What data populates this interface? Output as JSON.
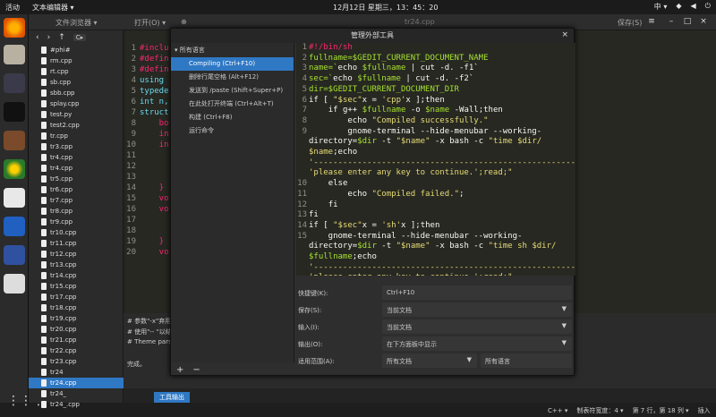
{
  "topbar": {
    "activities": "活动",
    "app_menu": "文本编辑器 ▾",
    "clock": "12月12日 星期三，13：45：20",
    "input_method": "中 ▾"
  },
  "header": {
    "browser_title": "文件浏览器 ▾",
    "open_label": "打开(O) ▾",
    "file_tab": "tr24.cpp",
    "save_label": "保存(S)"
  },
  "sidebar": {
    "location": "C▸",
    "files": [
      "#phi#",
      "rm.cpp",
      "rt.cpp",
      "sb.cpp",
      "sbb.cpp",
      "splay.cpp",
      "test.py",
      "test2.cpp",
      "tr.cpp",
      "tr3.cpp",
      "tr4.cpp",
      "tr4.cpp",
      "tr5.cpp",
      "tr6.cpp",
      "tr7.cpp",
      "tr8.cpp",
      "tr9.cpp",
      "tr10.cpp",
      "tr11.cpp",
      "tr12.cpp",
      "tr13.cpp",
      "tr14.cpp",
      "tr15.cpp",
      "tr17.cpp",
      "tr18.cpp",
      "tr19.cpp",
      "tr20.cpp",
      "tr21.cpp",
      "tr22.cpp",
      "tr23.cpp",
      "tr24",
      "tr24.cpp",
      "tr24_",
      "tr24_.cpp"
    ],
    "selected_index": 31
  },
  "editor": {
    "lines": [
      {
        "n": "1",
        "t": "#inclu"
      },
      {
        "n": "2",
        "t": "#defin"
      },
      {
        "n": "3",
        "t": "#defin"
      },
      {
        "n": "4",
        "t": "using "
      },
      {
        "n": "5",
        "t": "typede"
      },
      {
        "n": "6",
        "t": "int n,"
      },
      {
        "n": "7",
        "t": "struct"
      },
      {
        "n": "8",
        "t": "    bo"
      },
      {
        "n": "9",
        "t": "    in"
      },
      {
        "n": "10",
        "t": "    in"
      },
      {
        "n": "11",
        "t": ""
      },
      {
        "n": "12",
        "t": ""
      },
      {
        "n": "13",
        "t": ""
      },
      {
        "n": "14",
        "t": "    }"
      },
      {
        "n": "15",
        "t": "    vo"
      },
      {
        "n": "16",
        "t": "    vo"
      },
      {
        "n": "17",
        "t": ""
      },
      {
        "n": "18",
        "t": ""
      },
      {
        "n": "19",
        "t": "    }"
      },
      {
        "n": "20",
        "t": "    vo"
      }
    ]
  },
  "lower_pane": {
    "line1": "# 参数\"-x\"弃用...",
    "line2": "# 使用\"-- \"以结...",
    "line3": "# Theme parsing...",
    "done": "完成。",
    "tool_output_tab": "工具输出"
  },
  "status": {
    "lang": "C++ ▾",
    "tab_width": "制表符宽度：4 ▾",
    "position": "第 7 行，第 18 列 ▾",
    "mode": "插入"
  },
  "dialog": {
    "title": "管理外部工具",
    "tools_heading": "所有语言",
    "tools": [
      "Compiling (Ctrl+F10)",
      "删除行尾空格 (Alt+F12)",
      "发送到 /paste (Shift+Super+P)",
      "在此处打开终端 (Ctrl+Alt+T)",
      "构建 (Ctrl+F8)",
      "运行命令"
    ],
    "selected_tool": 0,
    "add": "+",
    "remove": "−",
    "props": {
      "shortcut_label": "快捷键(K):",
      "shortcut_value": "Ctrl+F10",
      "save_label": "保存(S):",
      "save_value": "当前文档",
      "input_label": "输入(I):",
      "input_value": "当前文档",
      "output_label": "输出(O):",
      "output_value": "在下方面板中显示",
      "apply_label": "适用范围(A):",
      "apply_value": "所有文档",
      "apply_lang": "所有语言"
    }
  },
  "colors": {
    "accent": "#2f78c4",
    "editor_bg": "#272822",
    "keyword": "#f92672",
    "string": "#e6db74",
    "variable": "#a6e22e"
  }
}
